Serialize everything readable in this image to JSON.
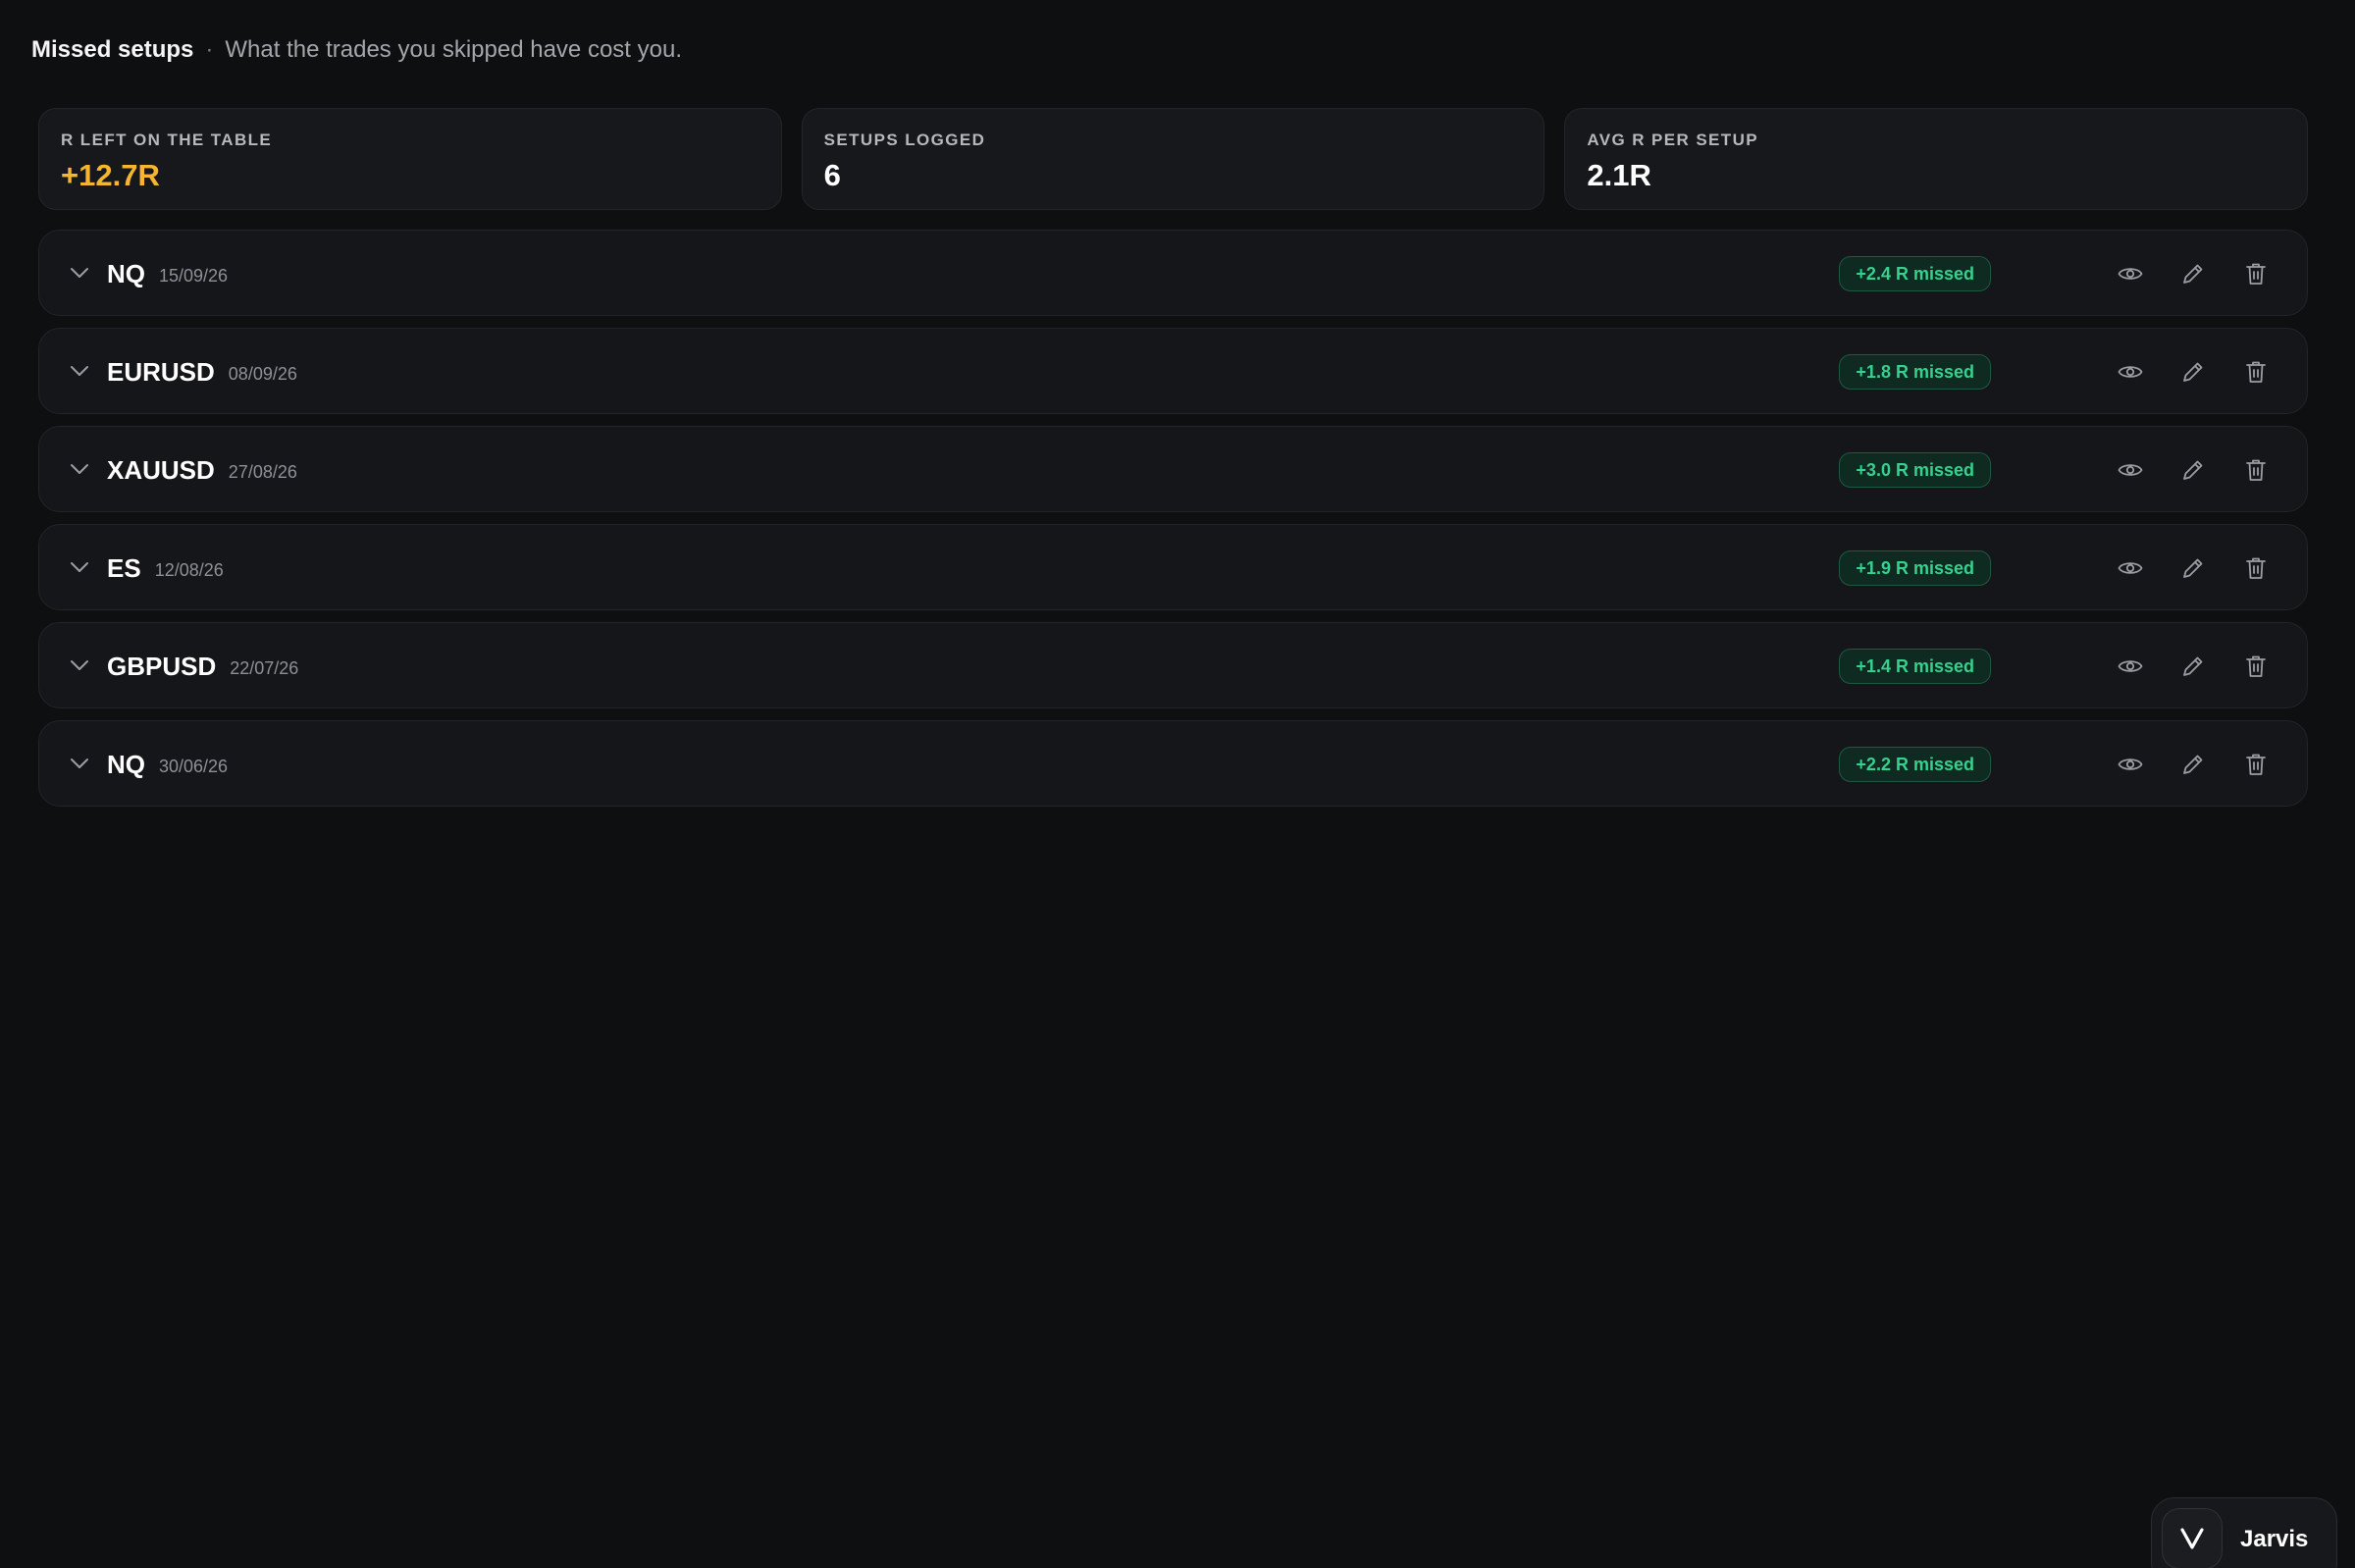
{
  "header": {
    "title": "Missed setups",
    "separator": "·",
    "subtitle": "What the trades you skipped have cost you."
  },
  "stats": [
    {
      "label": "R LEFT ON THE TABLE",
      "value": "+12.7R",
      "color": "#f5b52e"
    },
    {
      "label": "SETUPS LOGGED",
      "value": "6",
      "color": "#ffffff"
    },
    {
      "label": "AVG R PER SETUP",
      "value": "2.1R",
      "color": "#ffffff"
    }
  ],
  "setups": [
    {
      "symbol": "NQ",
      "date": "15/09/26",
      "badge": "+2.4 R missed"
    },
    {
      "symbol": "EURUSD",
      "date": "08/09/26",
      "badge": "+1.8 R missed"
    },
    {
      "symbol": "XAUUSD",
      "date": "27/08/26",
      "badge": "+3.0 R missed"
    },
    {
      "symbol": "ES",
      "date": "12/08/26",
      "badge": "+1.9 R missed"
    },
    {
      "symbol": "GBPUSD",
      "date": "22/07/26",
      "badge": "+1.4 R missed"
    },
    {
      "symbol": "NQ",
      "date": "30/06/26",
      "badge": "+2.2 R missed"
    }
  ],
  "icons": {
    "expand": "chevron-down-icon",
    "view": "eye-icon",
    "edit": "pencil-icon",
    "delete": "trash-icon"
  },
  "assistant": {
    "logo": "V",
    "label": "Jarvis"
  },
  "colors": {
    "background": "#0e0f11",
    "card": "#17181b",
    "accent": "#f5b52e",
    "badge_text": "#37d08e",
    "badge_bg": "#0f2a20"
  }
}
